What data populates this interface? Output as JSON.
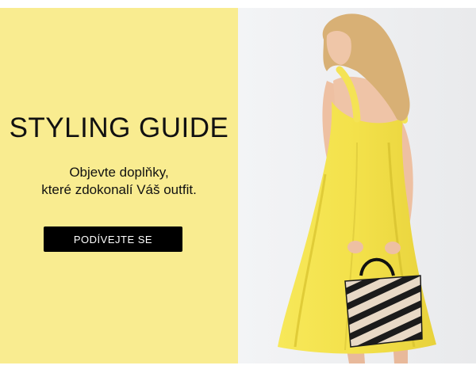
{
  "banner": {
    "headline": "STYLING GUIDE",
    "subtext_line1": "Objevte doplňky,",
    "subtext_line2": "které zdokonalí Váš outfit.",
    "cta_label": "PODÍVEJTE SE"
  },
  "colors": {
    "panel_background": "#f9ec90",
    "cta_background": "#000000",
    "cta_text": "#ffffff",
    "photo_background": "#eeeff1",
    "dress": "#f5e44e"
  },
  "photo": {
    "subject": "model-in-yellow-dress-with-zebra-bag"
  }
}
